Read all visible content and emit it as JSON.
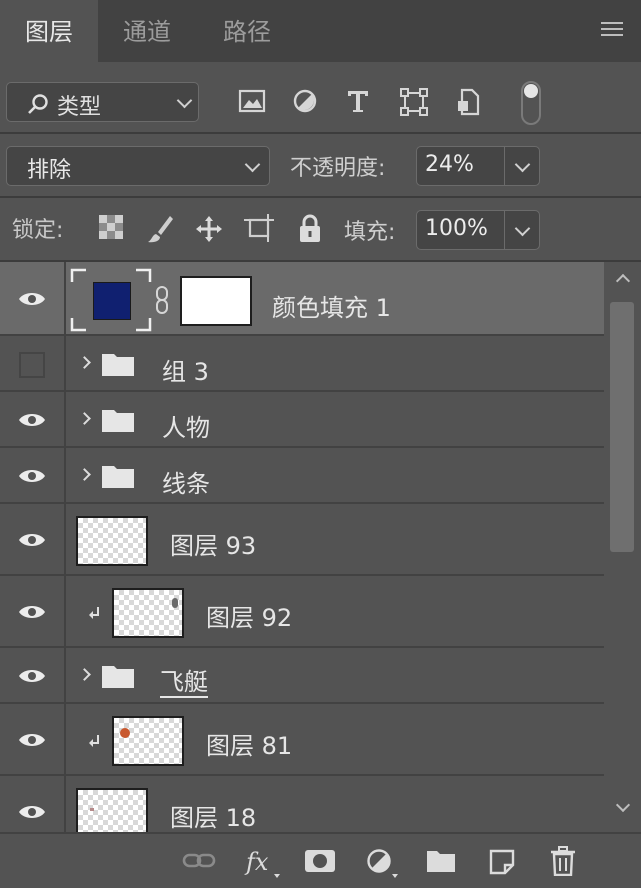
{
  "tabs": [
    {
      "label": "图层",
      "active": true
    },
    {
      "label": "通道",
      "active": false
    },
    {
      "label": "路径",
      "active": false
    }
  ],
  "filter": {
    "kind_label": "类型",
    "icons": [
      "image-filter-icon",
      "adjustment-filter-icon",
      "type-filter-icon",
      "shape-filter-icon",
      "smart-object-filter-icon"
    ]
  },
  "blend": {
    "mode": "排除",
    "opacity_label": "不透明度:",
    "opacity_value": "24%"
  },
  "lock": {
    "label": "锁定:",
    "fill_label": "填充:",
    "fill_value": "100%",
    "icons": [
      "lock-transparent-pixels-icon",
      "lock-image-pixels-icon",
      "lock-position-icon",
      "lock-artboard-icon",
      "lock-all-icon"
    ]
  },
  "layers": [
    {
      "name": "颜色填充 1",
      "type": "fill",
      "visible": true,
      "selected": true,
      "fill_color": "#102070"
    },
    {
      "name": "组 3",
      "type": "group",
      "visible": false
    },
    {
      "name": "人物",
      "type": "group",
      "visible": true
    },
    {
      "name": "线条",
      "type": "group",
      "visible": true
    },
    {
      "name": "图层 93",
      "type": "pixel",
      "visible": true
    },
    {
      "name": "图层 92",
      "type": "pixel",
      "visible": true,
      "clipped": true
    },
    {
      "name": "飞艇",
      "type": "group",
      "visible": true,
      "underlined": true
    },
    {
      "name": "图层 81",
      "type": "pixel",
      "visible": true,
      "clipped": true
    },
    {
      "name": "图层 18",
      "type": "pixel",
      "visible": true,
      "underlined": true
    }
  ],
  "bottom_toolbar": [
    "link-layers-icon",
    "fx-icon",
    "add-mask-icon",
    "adjustment-layer-icon",
    "new-group-icon",
    "new-layer-icon",
    "delete-layer-icon"
  ],
  "colors": {
    "panel": "#535353",
    "tab_bar": "#424242",
    "selected_row": "#6a6a6a"
  }
}
